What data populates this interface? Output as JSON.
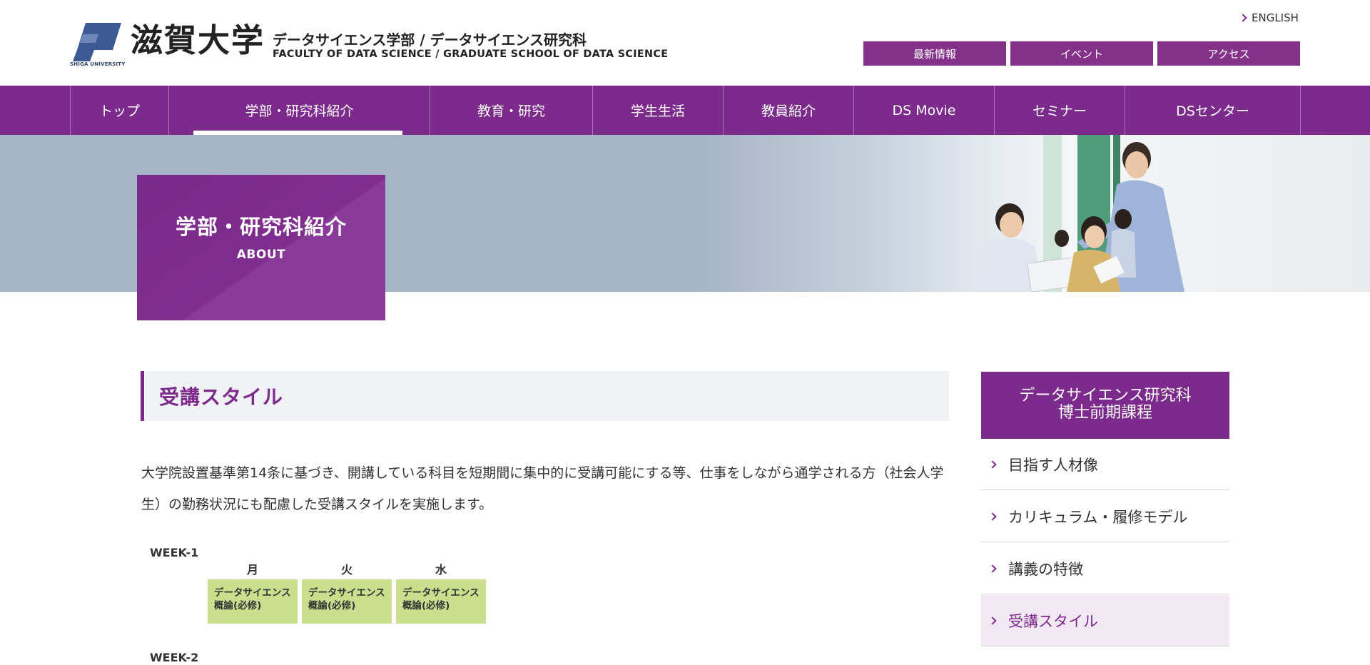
{
  "header": {
    "logo_jp": "滋賀大学",
    "logo_en": "SHIGA UNIVERSITY",
    "faculty_jp": "データサイエンス学部 / データサイエンス研究科",
    "faculty_en": "FACULTY OF DATA SCIENCE / GRADUATE SCHOOL OF DATA SCIENCE",
    "english_label": "ENGLISH",
    "buttons": [
      "最新情報",
      "イベント",
      "アクセス"
    ]
  },
  "nav": {
    "items": [
      "トップ",
      "学部・研究科紹介",
      "教育・研究",
      "学生生活",
      "教員紹介",
      "DS Movie",
      "セミナー",
      "DSセンター"
    ],
    "active": "学部・研究科紹介"
  },
  "hero": {
    "title": "学部・研究科紹介",
    "subtitle": "ABOUT"
  },
  "main": {
    "heading": "受講スタイル",
    "body": "大学院設置基準第14条に基づき、開講している科目を短期間に集中的に受講可能にする等、仕事をしながら通学される方（社会人学生）の勤務状況にも配慮した受講スタイルを実施します。",
    "schedule": {
      "week1_label": "WEEK-1",
      "week2_label": "WEEK-2",
      "days": [
        "月",
        "火",
        "水"
      ],
      "courses": [
        {
          "line1": "データサイエンス",
          "line2": "概論(必修)"
        },
        {
          "line1": "データサイエンス",
          "line2": "概論(必修)"
        },
        {
          "line1": "データサイエンス",
          "line2": "概論(必修)"
        }
      ]
    }
  },
  "sidebar": {
    "heading_line1": "データサイエンス研究科",
    "heading_line2": "博士前期課程",
    "items": [
      "目指す人材像",
      "カリキュラム・履修モデル",
      "講義の特徴",
      "受講スタイル"
    ],
    "active": "受講スタイル"
  },
  "colors": {
    "brand_purple": "#7c2a8c",
    "hero_bg": "#a5b4c7",
    "course_green": "#c9df8d",
    "sidebar_active_bg": "#f1e8f3"
  }
}
